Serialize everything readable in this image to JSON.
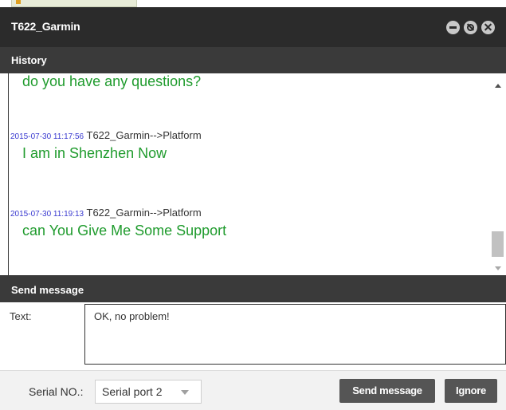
{
  "window": {
    "title": "T622_Garmin"
  },
  "history": {
    "header": "History",
    "messages": [
      {
        "text": "do you have any questions?"
      },
      {
        "timestamp": "2015-07-30 11:17:56",
        "route": "T622_Garmin-->Platform",
        "text": "I am in Shenzhen Now"
      },
      {
        "timestamp": "2015-07-30 11:19:13",
        "route": "T622_Garmin-->Platform",
        "text": "can You Give Me Some Support"
      }
    ]
  },
  "send": {
    "header": "Send message",
    "text_label": "Text:",
    "text_value": "OK, no problem!"
  },
  "footer": {
    "serial_label": "Serial NO.:",
    "serial_selected": "Serial port 2",
    "send_button": "Send message",
    "ignore_button": "Ignore"
  },
  "colors": {
    "titlebar": "#2b2b2b",
    "section_header": "#3a3a3a",
    "message_text": "#1f9b2d",
    "timestamp": "#3a3ad0",
    "button": "#555555"
  }
}
